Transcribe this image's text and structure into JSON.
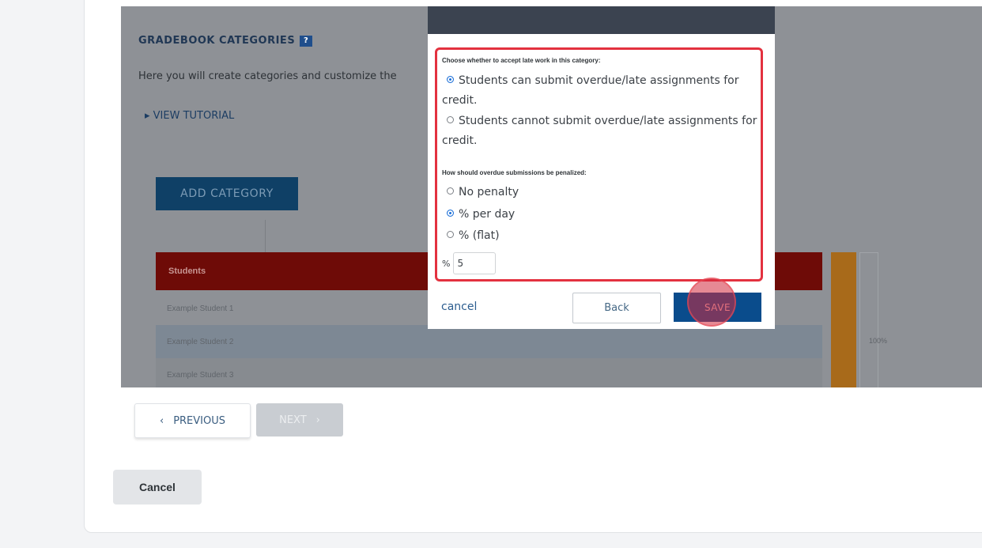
{
  "gradebook": {
    "title": "GRADEBOOK CATEGORIES",
    "help_icon": "?",
    "description": "Here you will create categories and customize the",
    "tutorial_link": "▸ VIEW TUTORIAL",
    "add_category": "ADD CATEGORY",
    "table": {
      "header": "Students",
      "rows": [
        "Example Student 1",
        "Example Student 2",
        "Example Student 3"
      ]
    },
    "percent_label": "100%"
  },
  "modal": {
    "late_work_label": "Choose whether to accept late work in this category:",
    "late_options": [
      {
        "label": "Students can submit overdue/late assignments for credit.",
        "checked": true
      },
      {
        "label": "Students cannot submit overdue/late assignments for credit.",
        "checked": false
      }
    ],
    "penalty_label": "How should overdue submissions be penalized:",
    "penalty_options": [
      {
        "label": "No penalty",
        "checked": false
      },
      {
        "label": "% per day",
        "checked": true
      },
      {
        "label": "% (flat)",
        "checked": false
      }
    ],
    "percent_prefix": "%",
    "percent_value": "5",
    "cancel": "cancel",
    "back": "Back",
    "save": "SAVE"
  },
  "footer": {
    "previous": "PREVIOUS",
    "next": "NEXT",
    "cancel": "Cancel"
  },
  "colors": {
    "highlight": "#e3313f",
    "save_button": "#0a4c8c",
    "table_header": "#6e0b07"
  }
}
